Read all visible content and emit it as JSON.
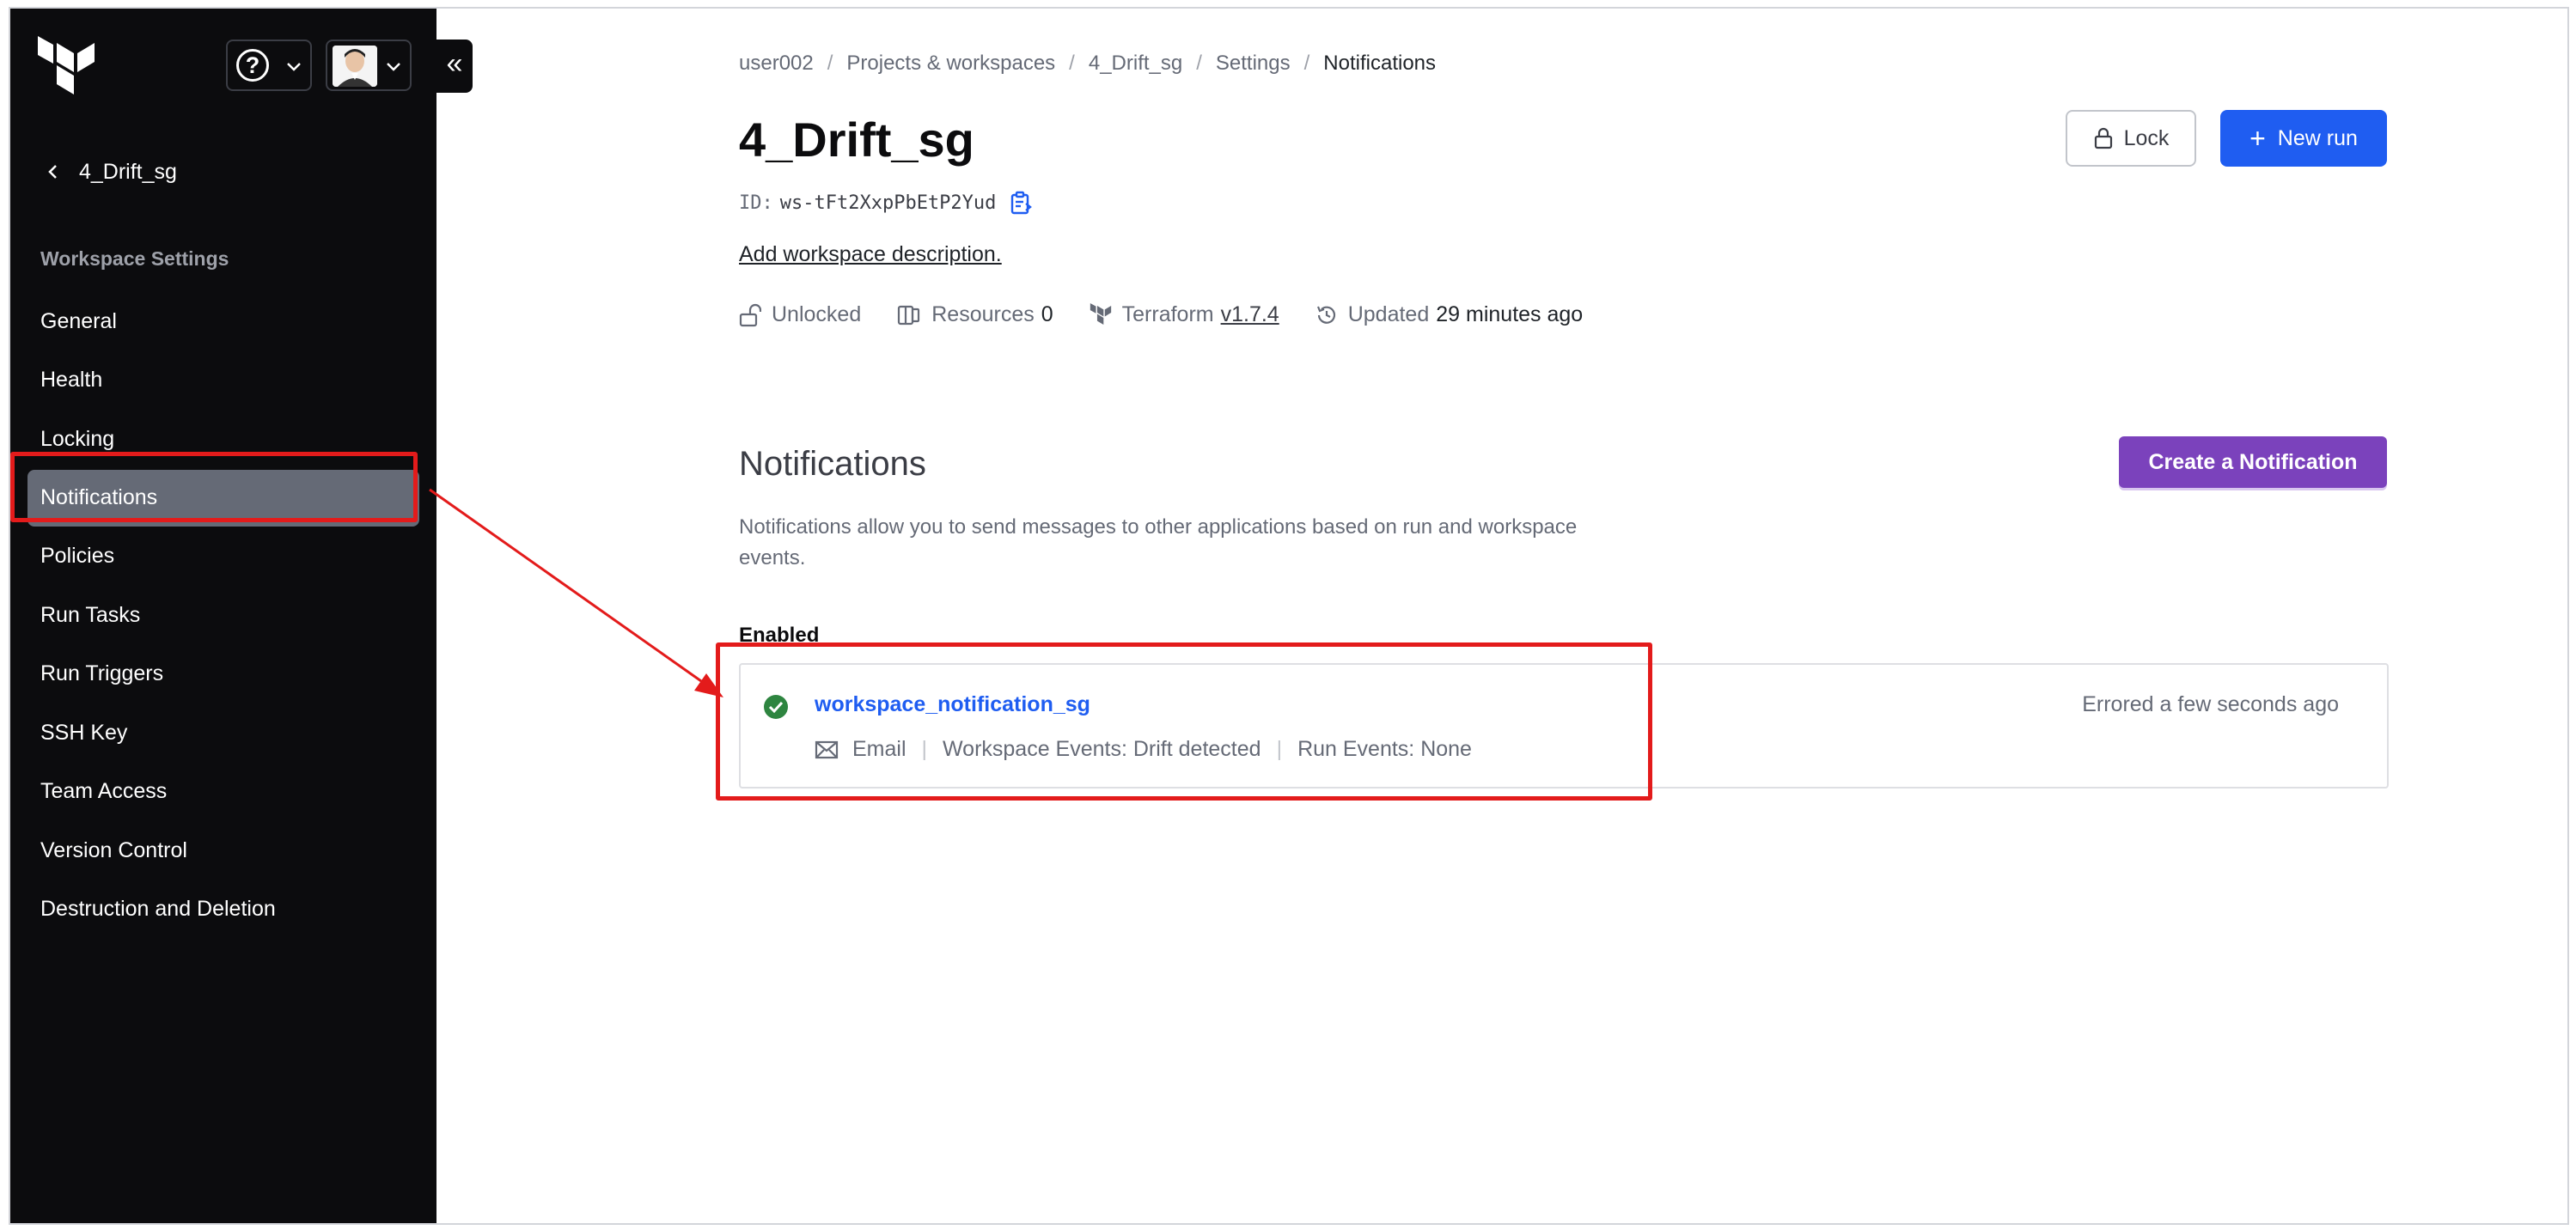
{
  "sidebar": {
    "back_label": "4_Drift_sg",
    "heading": "Workspace Settings",
    "items": [
      {
        "label": "General"
      },
      {
        "label": "Health"
      },
      {
        "label": "Locking"
      },
      {
        "label": "Notifications"
      },
      {
        "label": "Policies"
      },
      {
        "label": "Run Tasks"
      },
      {
        "label": "Run Triggers"
      },
      {
        "label": "SSH Key"
      },
      {
        "label": "Team Access"
      },
      {
        "label": "Version Control"
      },
      {
        "label": "Destruction and Deletion"
      }
    ],
    "active_index": 3,
    "collapse_label": "«",
    "help_label": "?"
  },
  "breadcrumb": {
    "items": [
      "user002",
      "Projects & workspaces",
      "4_Drift_sg",
      "Settings",
      "Notifications"
    ],
    "separator": "/"
  },
  "workspace": {
    "title": "4_Drift_sg",
    "id_label": "ID:",
    "id_value": "ws-tFt2XxpPbEtP2Yud",
    "add_description": "Add workspace description.",
    "lock_state": "Unlocked",
    "resources_label": "Resources",
    "resources_count": "0",
    "terraform_label": "Terraform",
    "terraform_version": "v1.7.4",
    "updated_label": "Updated",
    "updated_value": "29 minutes ago"
  },
  "actions": {
    "lock_label": "Lock",
    "new_run_label": "New run",
    "new_run_plus": "+"
  },
  "notifications": {
    "title": "Notifications",
    "create_label": "Create a Notification",
    "description": "Notifications allow you to send messages to other applications based on run and workspace events.",
    "enabled_label": "Enabled",
    "items": [
      {
        "name": "workspace_notification_sg",
        "status": "Errored a few seconds ago",
        "type": "Email",
        "workspace_events": "Workspace Events: Drift detected",
        "run_events": "Run Events: None",
        "separator": "|"
      }
    ]
  },
  "colors": {
    "sidebar_bg": "#0c0c0e",
    "active_item": "#656a76",
    "primary": "#1f5df1",
    "purple": "#7b42bc",
    "highlight": "#e31b1b",
    "success": "#2e8540"
  }
}
